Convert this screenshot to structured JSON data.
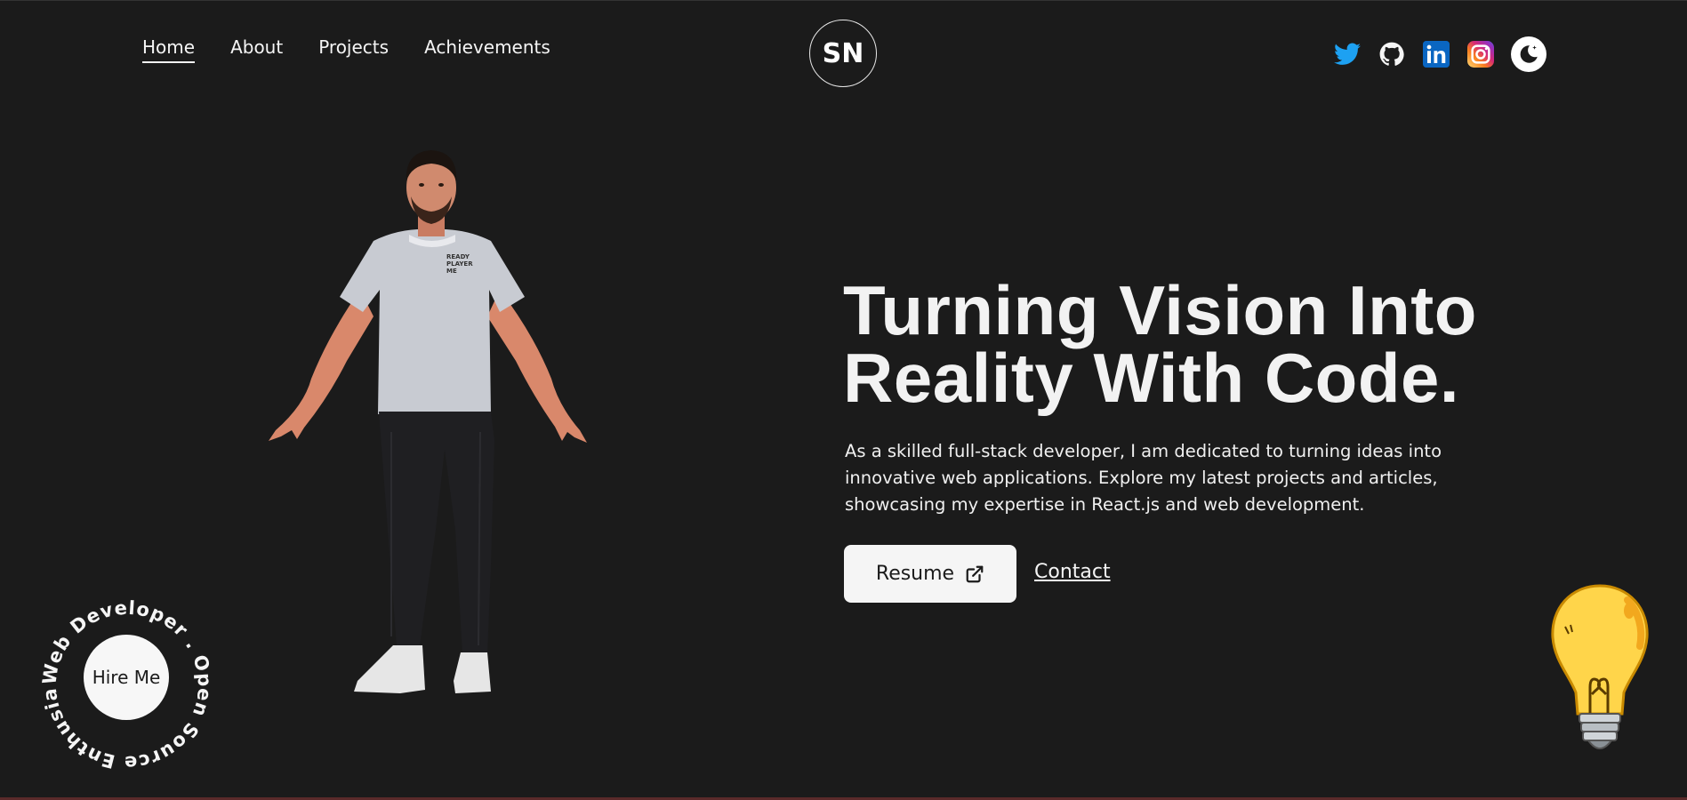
{
  "nav": {
    "items": [
      {
        "label": "Home",
        "active": true
      },
      {
        "label": "About",
        "active": false
      },
      {
        "label": "Projects",
        "active": false
      },
      {
        "label": "Achievements",
        "active": false
      }
    ]
  },
  "logo": {
    "text": "SN"
  },
  "social": {
    "icons": [
      "twitter-icon",
      "github-icon",
      "linkedin-icon",
      "instagram-icon"
    ],
    "theme_toggle_icon": "moon-icon"
  },
  "hero": {
    "title": "Turning Vision Into Reality With Code.",
    "description": "As a skilled full-stack developer, I am dedicated to turning ideas into innovative web applications. Explore my latest projects and articles, showcasing my expertise in React.js and web development.",
    "resume_label": "Resume",
    "contact_label": "Contact"
  },
  "hire": {
    "button_label": "Hire Me",
    "circular_text": "Web Developer . Open Source Enthusiast . "
  },
  "avatar": {
    "shirt_text": "READY PLAYER ME"
  },
  "colors": {
    "background": "#1b1b1b",
    "text": "#f5f5f5",
    "twitter": "#1da1f2",
    "linkedin": "#0a66c2",
    "bulb": "#ffd54a"
  }
}
